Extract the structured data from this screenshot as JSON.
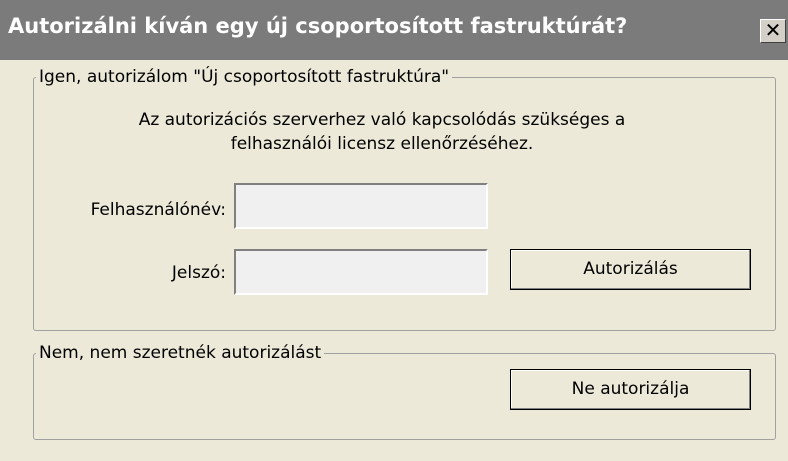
{
  "window": {
    "title": "Autorizálni kíván egy új csoportosított fastruktúrát?",
    "close_glyph": "✕"
  },
  "group_yes": {
    "legend": "Igen, autorizálom \"Új csoportosított fastruktúra\"",
    "message_line1": "Az autorizációs szerverhez való kapcsolódás szükséges a",
    "message_line2": "felhasználói licensz ellenőrzéséhez.",
    "username_label": "Felhasználónév:",
    "username_value": "",
    "password_label": "Jelszó:",
    "password_value": "",
    "authorize_button": "Autorizálás"
  },
  "group_no": {
    "legend": "Nem, nem szeretnék autorizálást",
    "no_authorize_button": "Ne autorizálja"
  },
  "colors": {
    "titlebar": "#7b7b7b",
    "background": "#ece9d8",
    "input_bg": "#f0f0f0"
  }
}
